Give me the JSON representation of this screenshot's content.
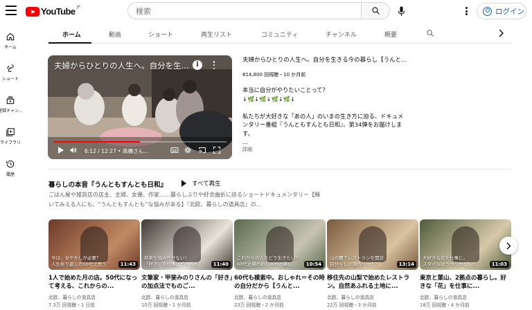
{
  "header": {
    "logo_text": "YouTube",
    "logo_region": "JP",
    "search_placeholder": "検索",
    "login_label": "ログイン"
  },
  "sidebar": {
    "items": [
      {
        "label": "ホーム",
        "icon": "home-icon"
      },
      {
        "label": "ショート",
        "icon": "shorts-icon"
      },
      {
        "label": "登録チャン...",
        "icon": "subscriptions-icon"
      },
      {
        "label": "ライブラリ",
        "icon": "library-icon"
      },
      {
        "label": "履歴",
        "icon": "history-icon"
      }
    ]
  },
  "tabs": [
    {
      "label": "ホーム",
      "active": true
    },
    {
      "label": "動画",
      "active": false
    },
    {
      "label": "ショート",
      "active": false
    },
    {
      "label": "再生リスト",
      "active": false
    },
    {
      "label": "コミュニティ",
      "active": false
    },
    {
      "label": "チャンネル",
      "active": false
    },
    {
      "label": "概要",
      "active": false
    }
  ],
  "featured": {
    "overlay_title": "夫婦からひとりの人生へ。自分を生...",
    "title": "夫婦からひとりの人生へ。自分を生きる今の暮らし【うんと...",
    "meta": "814,800 回視聴・10 か月前",
    "description": "本当に自分がやりたいことって？\n↓🌿↓🌿↓🌿↓🌿↓\n\n私たちが大好きな「あの人」のいまの生き方に迫る、ドキュメンタリー番組『うんともすんとも日和』、第34弾をお届けします。\n...",
    "more_label": "詳細",
    "time": "6:12 / 12:27 • 高橋さん...",
    "progress": 0.5
  },
  "shelf": {
    "title": "暮らしの本音『うんともすんとも日和』",
    "play_all": "すべて再生",
    "description": "ごはん屋や雑貨店の店主、主婦、女優、作家……暮らしぶりや紆余曲折に迫るショートドキュメンタリー【輝いてみえる人にも、“うんともすんとも”な悩みがある】『北欧、暮らしの道具店』の..."
  },
  "videos": [
    {
      "thumb_caption": "今は、甘やかしが必要？\n人生折り返しの50代で思う",
      "duration": "11:43",
      "title": "1人で始めた月の店。50代になって考える、これからの...",
      "channel": "北欧、暮らしの道具店",
      "meta": "7.3万 回視聴・1 日前",
      "colors": [
        "#6e3a2a",
        "#c08a63"
      ]
    },
    {
      "thumb_caption": "将来を悩みがせない！\n「好き」を仕事にできるま",
      "duration": "11:40",
      "title": "文筆家・甲斐みのりさんの「好き」の加点法でものご...",
      "channel": "北欧、暮らしの道具店",
      "meta": "10万 回視聴・1 か月前",
      "colors": [
        "#3f3a33",
        "#e8e3da"
      ]
    },
    {
      "thumb_caption": "これからの人生どう生きたい？\n60代主婦のおしゃれの楽し",
      "duration": "10:54",
      "title": "60代も模索中。おしゃれ＝その時の自分だから【うんと...",
      "channel": "北欧、暮らしの道具店",
      "meta": "23万 回視聴・2 か月前",
      "colors": [
        "#5b6b4f",
        "#c8c4b4"
      ]
    },
    {
      "thumb_caption": "山の麓でレストランを開店\n自分らしい道のりって？",
      "duration": "13:14",
      "title": "移住先の山梨で始めたレストラン。自然あふれる土地に...",
      "channel": "北欧、暮らしの道具店",
      "meta": "22万 回視聴・3 か月前",
      "colors": [
        "#7a5a3c",
        "#d9c3a1"
      ]
    },
    {
      "thumb_caption": "大好きな花を仕事に。\nスタイルはうつりかなくて",
      "duration": "11:03",
      "title": "東京と葉山、2拠点の暮らし。好きな「花」を仕事に...",
      "channel": "北欧、暮らしの道具店",
      "meta": "18万 回視聴・4 か月前",
      "colors": [
        "#4f5b3d",
        "#d7c9a8"
      ]
    }
  ]
}
